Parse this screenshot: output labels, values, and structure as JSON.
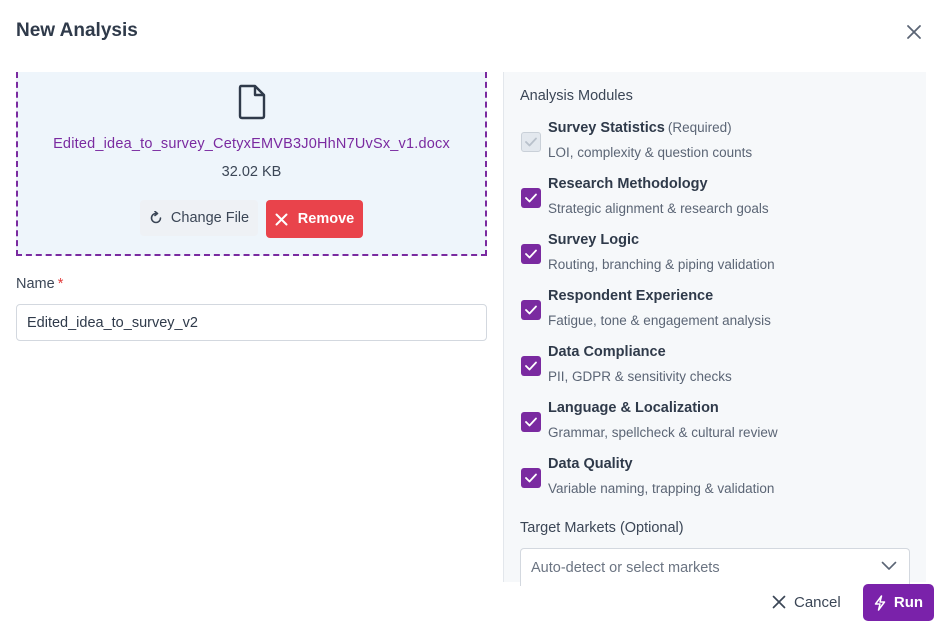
{
  "dialog": {
    "title": "New Analysis"
  },
  "upload": {
    "file_name": "Edited_idea_to_survey_CetyxEMVB3J0HhN7UvSx_v1.docx",
    "file_size": "32.02 KB",
    "change_label": "Change File",
    "remove_label": "Remove"
  },
  "name_field": {
    "label": "Name",
    "required_mark": "*",
    "value": "Edited_idea_to_survey_v2"
  },
  "modules": {
    "title": "Analysis Modules",
    "items": [
      {
        "name": "Survey Statistics",
        "tag": "(Required)",
        "desc": "LOI, complexity & question counts",
        "checked": true,
        "disabled": true
      },
      {
        "name": "Research Methodology",
        "tag": "",
        "desc": "Strategic alignment & research goals",
        "checked": true,
        "disabled": false
      },
      {
        "name": "Survey Logic",
        "tag": "",
        "desc": "Routing, branching & piping validation",
        "checked": true,
        "disabled": false
      },
      {
        "name": "Respondent Experience",
        "tag": "",
        "desc": "Fatigue, tone & engagement analysis",
        "checked": true,
        "disabled": false
      },
      {
        "name": "Data Compliance",
        "tag": "",
        "desc": "PII, GDPR & sensitivity checks",
        "checked": true,
        "disabled": false
      },
      {
        "name": "Language & Localization",
        "tag": "",
        "desc": "Grammar, spellcheck & cultural review",
        "checked": true,
        "disabled": false
      },
      {
        "name": "Data Quality",
        "tag": "",
        "desc": "Variable naming, trapping & validation",
        "checked": true,
        "disabled": false
      }
    ]
  },
  "markets": {
    "label": "Target Markets",
    "optional": "(Optional)",
    "placeholder": "Auto-detect or select markets"
  },
  "footer": {
    "cancel_label": "Cancel",
    "run_label": "Run"
  },
  "colors": {
    "accent": "#7a22aa",
    "danger": "#e9434b",
    "panel_bg": "#f6f8fa",
    "dropzone_bg": "#eef5fb"
  },
  "icons": [
    "close-icon",
    "file-icon",
    "refresh-icon",
    "x-icon",
    "check-icon",
    "chevron-down-icon",
    "lightning-icon"
  ]
}
